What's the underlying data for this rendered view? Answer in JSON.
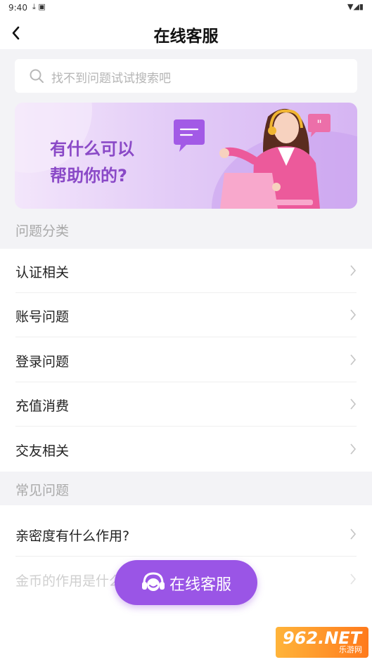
{
  "status_bar": {
    "time": "9:40"
  },
  "header": {
    "title": "在线客服"
  },
  "search": {
    "placeholder": "找不到问题试试搜索吧"
  },
  "banner": {
    "line1": "有什么可以",
    "line2": "帮助你的?"
  },
  "categories": {
    "title": "问题分类",
    "items": [
      {
        "label": "认证相关"
      },
      {
        "label": "账号问题"
      },
      {
        "label": "登录问题"
      },
      {
        "label": "充值消费"
      },
      {
        "label": "交友相关"
      }
    ]
  },
  "faq": {
    "title": "常见问题",
    "items": [
      {
        "label": "亲密度有什么作用?"
      },
      {
        "label": "金币的作用是什么?"
      }
    ]
  },
  "fab": {
    "label": "在线客服"
  },
  "watermark": {
    "num": "962.NET",
    "cn": "乐游网"
  },
  "colors": {
    "accent": "#9a55e6",
    "banner_text": "#8a49c7",
    "section_bg": "#f3f3f6"
  }
}
